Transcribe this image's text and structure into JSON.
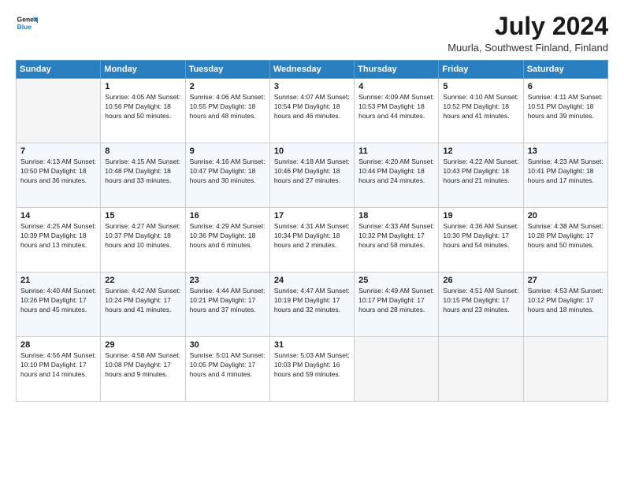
{
  "header": {
    "logo_line1": "General",
    "logo_line2": "Blue",
    "month_year": "July 2024",
    "location": "Muurla, Southwest Finland, Finland"
  },
  "days_of_week": [
    "Sunday",
    "Monday",
    "Tuesday",
    "Wednesday",
    "Thursday",
    "Friday",
    "Saturday"
  ],
  "weeks": [
    [
      {
        "day": "",
        "info": ""
      },
      {
        "day": "1",
        "info": "Sunrise: 4:05 AM\nSunset: 10:56 PM\nDaylight: 18 hours\nand 50 minutes."
      },
      {
        "day": "2",
        "info": "Sunrise: 4:06 AM\nSunset: 10:55 PM\nDaylight: 18 hours\nand 48 minutes."
      },
      {
        "day": "3",
        "info": "Sunrise: 4:07 AM\nSunset: 10:54 PM\nDaylight: 18 hours\nand 46 minutes."
      },
      {
        "day": "4",
        "info": "Sunrise: 4:09 AM\nSunset: 10:53 PM\nDaylight: 18 hours\nand 44 minutes."
      },
      {
        "day": "5",
        "info": "Sunrise: 4:10 AM\nSunset: 10:52 PM\nDaylight: 18 hours\nand 41 minutes."
      },
      {
        "day": "6",
        "info": "Sunrise: 4:11 AM\nSunset: 10:51 PM\nDaylight: 18 hours\nand 39 minutes."
      }
    ],
    [
      {
        "day": "7",
        "info": "Sunrise: 4:13 AM\nSunset: 10:50 PM\nDaylight: 18 hours\nand 36 minutes."
      },
      {
        "day": "8",
        "info": "Sunrise: 4:15 AM\nSunset: 10:48 PM\nDaylight: 18 hours\nand 33 minutes."
      },
      {
        "day": "9",
        "info": "Sunrise: 4:16 AM\nSunset: 10:47 PM\nDaylight: 18 hours\nand 30 minutes."
      },
      {
        "day": "10",
        "info": "Sunrise: 4:18 AM\nSunset: 10:46 PM\nDaylight: 18 hours\nand 27 minutes."
      },
      {
        "day": "11",
        "info": "Sunrise: 4:20 AM\nSunset: 10:44 PM\nDaylight: 18 hours\nand 24 minutes."
      },
      {
        "day": "12",
        "info": "Sunrise: 4:22 AM\nSunset: 10:43 PM\nDaylight: 18 hours\nand 21 minutes."
      },
      {
        "day": "13",
        "info": "Sunrise: 4:23 AM\nSunset: 10:41 PM\nDaylight: 18 hours\nand 17 minutes."
      }
    ],
    [
      {
        "day": "14",
        "info": "Sunrise: 4:25 AM\nSunset: 10:39 PM\nDaylight: 18 hours\nand 13 minutes."
      },
      {
        "day": "15",
        "info": "Sunrise: 4:27 AM\nSunset: 10:37 PM\nDaylight: 18 hours\nand 10 minutes."
      },
      {
        "day": "16",
        "info": "Sunrise: 4:29 AM\nSunset: 10:36 PM\nDaylight: 18 hours\nand 6 minutes."
      },
      {
        "day": "17",
        "info": "Sunrise: 4:31 AM\nSunset: 10:34 PM\nDaylight: 18 hours\nand 2 minutes."
      },
      {
        "day": "18",
        "info": "Sunrise: 4:33 AM\nSunset: 10:32 PM\nDaylight: 17 hours\nand 58 minutes."
      },
      {
        "day": "19",
        "info": "Sunrise: 4:36 AM\nSunset: 10:30 PM\nDaylight: 17 hours\nand 54 minutes."
      },
      {
        "day": "20",
        "info": "Sunrise: 4:38 AM\nSunset: 10:28 PM\nDaylight: 17 hours\nand 50 minutes."
      }
    ],
    [
      {
        "day": "21",
        "info": "Sunrise: 4:40 AM\nSunset: 10:26 PM\nDaylight: 17 hours\nand 45 minutes."
      },
      {
        "day": "22",
        "info": "Sunrise: 4:42 AM\nSunset: 10:24 PM\nDaylight: 17 hours\nand 41 minutes."
      },
      {
        "day": "23",
        "info": "Sunrise: 4:44 AM\nSunset: 10:21 PM\nDaylight: 17 hours\nand 37 minutes."
      },
      {
        "day": "24",
        "info": "Sunrise: 4:47 AM\nSunset: 10:19 PM\nDaylight: 17 hours\nand 32 minutes."
      },
      {
        "day": "25",
        "info": "Sunrise: 4:49 AM\nSunset: 10:17 PM\nDaylight: 17 hours\nand 28 minutes."
      },
      {
        "day": "26",
        "info": "Sunrise: 4:51 AM\nSunset: 10:15 PM\nDaylight: 17 hours\nand 23 minutes."
      },
      {
        "day": "27",
        "info": "Sunrise: 4:53 AM\nSunset: 10:12 PM\nDaylight: 17 hours\nand 18 minutes."
      }
    ],
    [
      {
        "day": "28",
        "info": "Sunrise: 4:56 AM\nSunset: 10:10 PM\nDaylight: 17 hours\nand 14 minutes."
      },
      {
        "day": "29",
        "info": "Sunrise: 4:58 AM\nSunset: 10:08 PM\nDaylight: 17 hours\nand 9 minutes."
      },
      {
        "day": "30",
        "info": "Sunrise: 5:01 AM\nSunset: 10:05 PM\nDaylight: 17 hours\nand 4 minutes."
      },
      {
        "day": "31",
        "info": "Sunrise: 5:03 AM\nSunset: 10:03 PM\nDaylight: 16 hours\nand 59 minutes."
      },
      {
        "day": "",
        "info": ""
      },
      {
        "day": "",
        "info": ""
      },
      {
        "day": "",
        "info": ""
      }
    ]
  ]
}
